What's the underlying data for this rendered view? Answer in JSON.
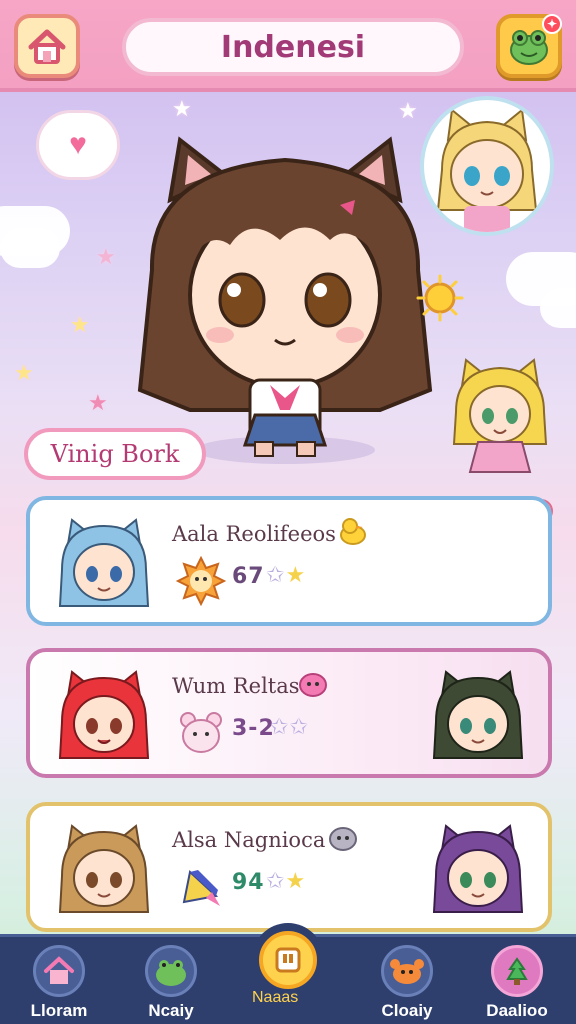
{
  "header": {
    "title": "Indenesi"
  },
  "character": {
    "name": "Vinig Bork"
  },
  "roster": [
    {
      "name": "Aala Reolifeeos",
      "score": "67",
      "stars_filled": 1,
      "stars_total": 2
    },
    {
      "name": "Wum Reltas",
      "score": "3-2",
      "stars_filled": 0,
      "stars_total": 2
    },
    {
      "name": "Alsa Nagnioca",
      "score": "94",
      "stars_filled": 1,
      "stars_total": 2
    }
  ],
  "nav": {
    "items": [
      {
        "label": "Lloram"
      },
      {
        "label": "Ncaiy"
      },
      {
        "label": "Naaas"
      },
      {
        "label": "Cloaiy"
      },
      {
        "label": "Daalioo"
      }
    ],
    "active_index": 2
  },
  "colors": {
    "header_pink": "#f7a6c6",
    "nav_bg": "#2e3f6e",
    "accent_yellow": "#ffd24d",
    "title_text": "#a23a77"
  },
  "icons": {
    "home": "house-icon",
    "friend": "frog-face-icon",
    "heart_bubble": "heart-icon"
  }
}
